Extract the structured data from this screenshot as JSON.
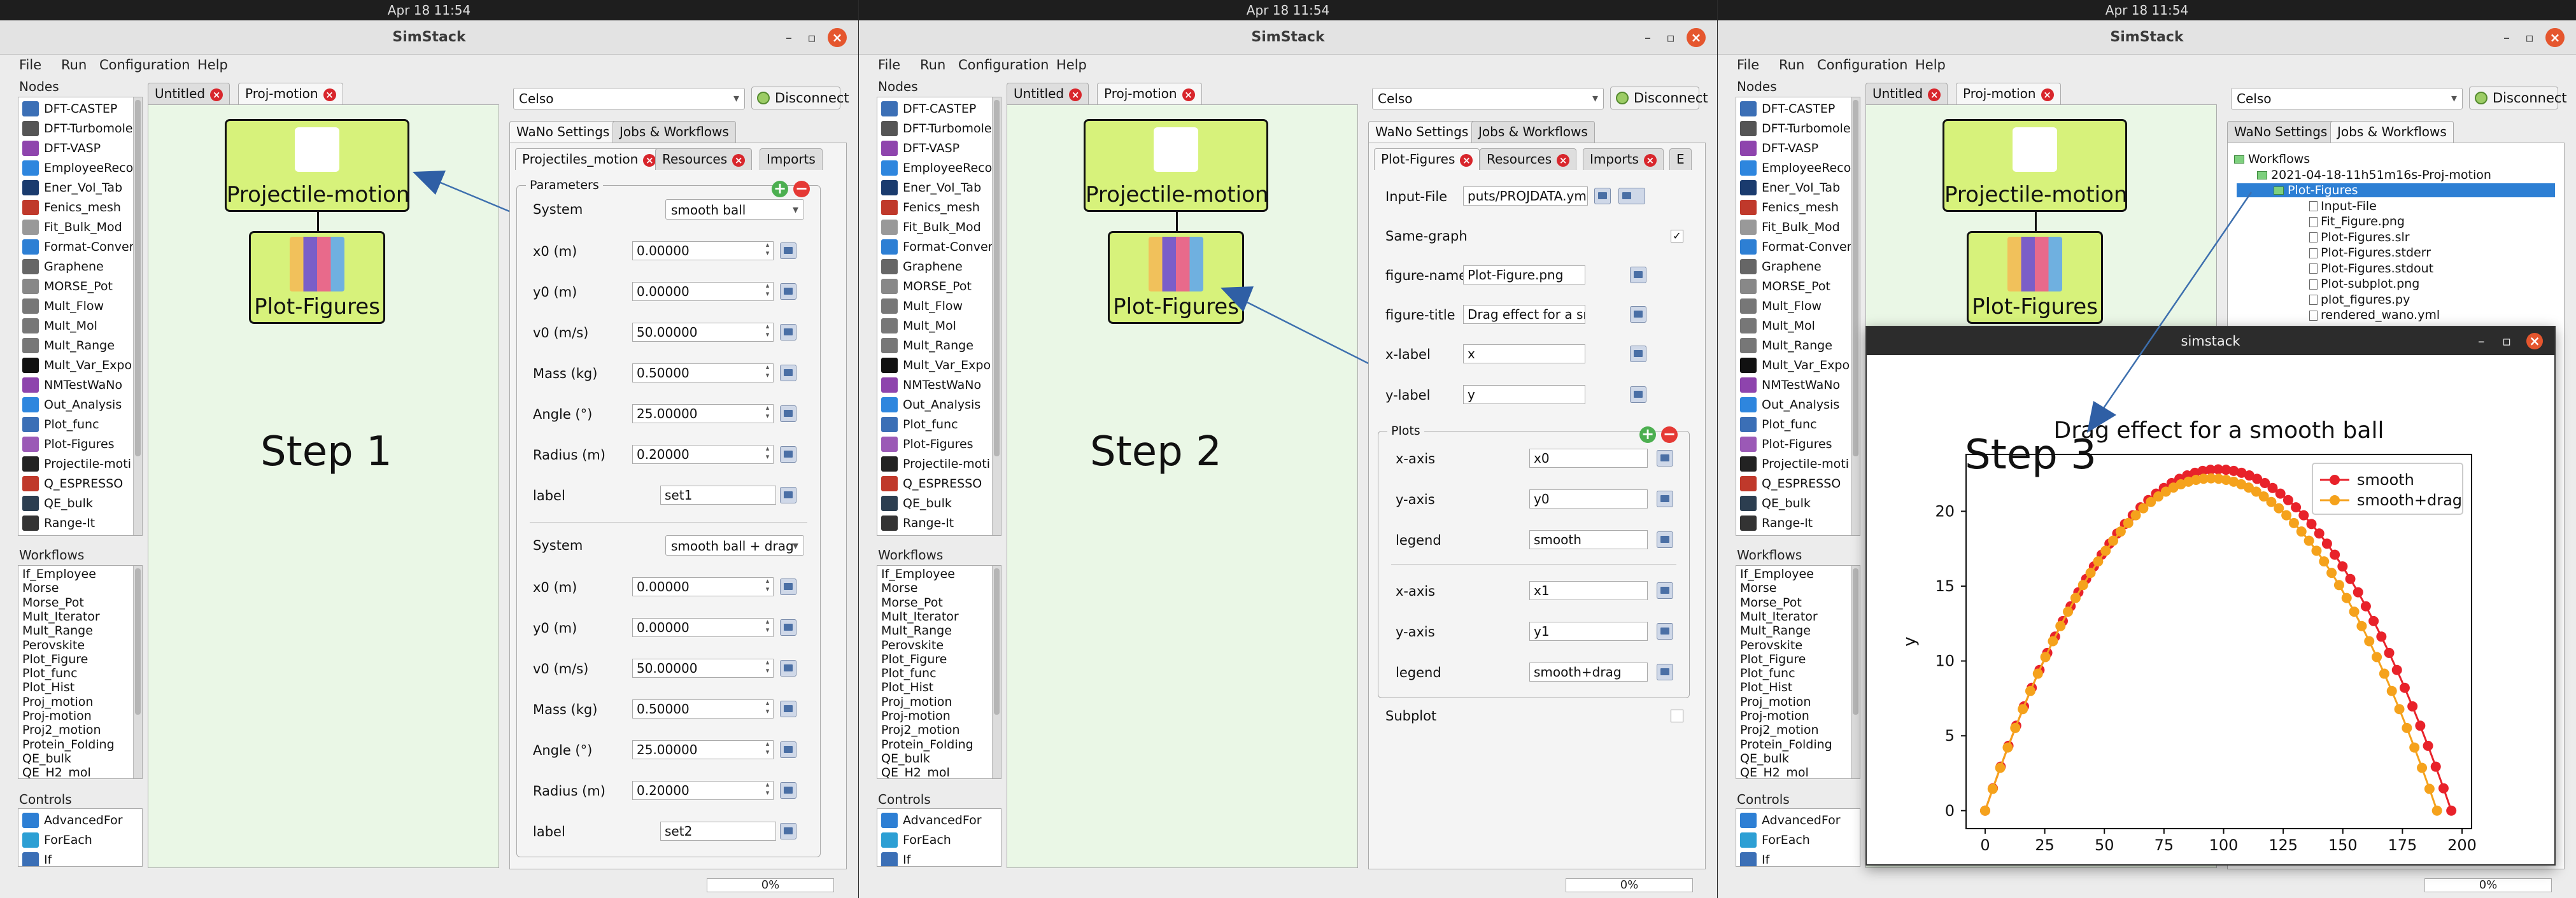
{
  "topbar": {
    "datetime": "Apr 18  11:54"
  },
  "window": {
    "title": "SimStack",
    "min": "–",
    "max": "▫",
    "close": "×"
  },
  "menu": {
    "file": "File",
    "run": "Run",
    "configuration": "Configuration",
    "help": "Help"
  },
  "sidebar": {
    "nodes_label": "Nodes",
    "nodes": [
      {
        "label": "DFT-CASTEP",
        "color": "#3b6fb6"
      },
      {
        "label": "DFT-Turbomole",
        "color": "#555555"
      },
      {
        "label": "DFT-VASP",
        "color": "#8e44ad"
      },
      {
        "label": "EmployeeReco",
        "color": "#2e86de"
      },
      {
        "label": "Ener_Vol_Tab",
        "color": "#1a3b6e"
      },
      {
        "label": "Fenics_mesh",
        "color": "#c0392b"
      },
      {
        "label": "Fit_Bulk_Mod",
        "color": "#999999"
      },
      {
        "label": "Format-Conver",
        "color": "#2d7fd4"
      },
      {
        "label": "Graphene",
        "color": "#666666"
      },
      {
        "label": "MORSE_Pot",
        "color": "#888888"
      },
      {
        "label": "Mult_Flow",
        "color": "#777777"
      },
      {
        "label": "Mult_Mol",
        "color": "#777777"
      },
      {
        "label": "Mult_Range",
        "color": "#777777"
      },
      {
        "label": "Mult_Var_Expo",
        "color": "#111111"
      },
      {
        "label": "NMTestWaNo",
        "color": "#8e44ad"
      },
      {
        "label": "Out_Analysis",
        "color": "#2e86de"
      },
      {
        "label": "Plot_func",
        "color": "#3b6fb6"
      },
      {
        "label": "Plot-Figures",
        "color": "#9b59b6"
      },
      {
        "label": "Projectile-moti",
        "color": "#222222"
      },
      {
        "label": "Q_ESPRESSO",
        "color": "#c0392b"
      },
      {
        "label": "QE_bulk",
        "color": "#2c3e50"
      },
      {
        "label": "Range-It",
        "color": "#333333"
      }
    ],
    "workflows_label": "Workflows",
    "workflows": [
      "If_Employee",
      "Morse",
      "Morse_Pot",
      "Mult_Iterator",
      "Mult_Range",
      "Perovskite",
      "Plot_Figure",
      "Plot_func",
      "Plot_Hist",
      "Proj_motion",
      "Proj-motion",
      "Proj2_motion",
      "Protein_Folding",
      "QE_bulk",
      "QE_H2_mol"
    ],
    "controls_label": "Controls",
    "controls": [
      {
        "label": "AdvancedFor",
        "color": "#2d7fd4"
      },
      {
        "label": "ForEach",
        "color": "#2d9fd4"
      },
      {
        "label": "If",
        "color": "#3b6fb6"
      }
    ]
  },
  "editor": {
    "tabs": [
      "Untitled",
      "Proj-motion"
    ],
    "nodes": {
      "projectile": "Projectile-motion",
      "plot": "Plot-Figures"
    },
    "steps": [
      "Step 1",
      "Step 2",
      "Step 3"
    ]
  },
  "right": {
    "server": "Celso",
    "disconnect": "Disconnect",
    "top_tabs": [
      "WaNo Settings",
      "Jobs & Workflows"
    ],
    "status": "0%"
  },
  "step1": {
    "tabs": [
      "Projectiles_motion",
      "Resources",
      "Imports"
    ],
    "parameters_title": "Parameters",
    "blocks": [
      {
        "system": "smooth ball",
        "x0": "0.00000",
        "y0": "0.00000",
        "v0": "50.00000",
        "mass": "0.50000",
        "angle": "25.00000",
        "radius": "0.20000",
        "label": "set1"
      },
      {
        "system": "smooth ball + drag",
        "x0": "0.00000",
        "y0": "0.00000",
        "v0": "50.00000",
        "mass": "0.50000",
        "angle": "25.00000",
        "radius": "0.20000",
        "label": "set2"
      }
    ],
    "labels": {
      "system": "System",
      "x0": "x0 (m)",
      "y0": "y0 (m)",
      "v0": "v0 (m/s)",
      "mass": "Mass (kg)",
      "angle": "Angle (°)",
      "radius": "Radius (m)",
      "label": "label"
    }
  },
  "step2": {
    "tabs": [
      "Plot-Figures",
      "Resources",
      "Imports",
      "E"
    ],
    "input_file_label": "Input-File",
    "input_file_value": "puts/PROJDATA.yml",
    "same_graph_label": "Same-graph",
    "same_graph_checked": "✓",
    "figure_name_label": "figure-name",
    "figure_name_value": "Plot-Figure.png",
    "figure_title_label": "figure-title",
    "figure_title_value": "Drag effect for a smo",
    "xlabel_label": "x-label",
    "xlabel_value": "x",
    "ylabel_label": "y-label",
    "ylabel_value": "y",
    "plots_title": "Plots",
    "plots": [
      {
        "xaxis": "x0",
        "yaxis": "y0",
        "legend": "smooth"
      },
      {
        "xaxis": "x1",
        "yaxis": "y1",
        "legend": "smooth+drag"
      }
    ],
    "xaxis_label": "x-axis",
    "yaxis_label": "y-axis",
    "legend_label": "legend",
    "subplot_label": "Subplot"
  },
  "step3": {
    "tree": [
      {
        "label": "Workflows",
        "kind": "root"
      },
      {
        "label": "2021-04-18-11h51m16s-Proj-motion",
        "kind": "folder"
      },
      {
        "label": "Plot-Figures",
        "kind": "folder",
        "selected": "yes"
      },
      {
        "label": "Input-File",
        "kind": "file"
      },
      {
        "label": "Fit_Figure.png",
        "kind": "file"
      },
      {
        "label": "Plot-Figures.slr",
        "kind": "file"
      },
      {
        "label": "Plot-Figures.stderr",
        "kind": "file"
      },
      {
        "label": "Plot-Figures.stdout",
        "kind": "file"
      },
      {
        "label": "Plot-subplot.png",
        "kind": "file"
      },
      {
        "label": "plot_figures.py",
        "kind": "file"
      },
      {
        "label": "rendered_wano.yml",
        "kind": "file"
      }
    ],
    "popup_title": "simstack"
  },
  "chart_data": {
    "type": "scatter",
    "title": "Drag effect for a smooth ball",
    "xlabel": "x",
    "ylabel": "y",
    "xlim": [
      -8,
      204
    ],
    "ylim": [
      -1.2,
      23.8
    ],
    "xticks": [
      0,
      25,
      50,
      75,
      100,
      125,
      150,
      175,
      200
    ],
    "yticks": [
      0,
      5,
      10,
      15,
      20
    ],
    "legend_position": "top-right",
    "series": [
      {
        "name": "smooth",
        "color": "#e8222a",
        "range_x": 195.5,
        "peak_y": 22.8
      },
      {
        "name": "smooth+drag",
        "color": "#f5a21c",
        "range_x": 189.5,
        "peak_y": 22.2
      }
    ]
  }
}
